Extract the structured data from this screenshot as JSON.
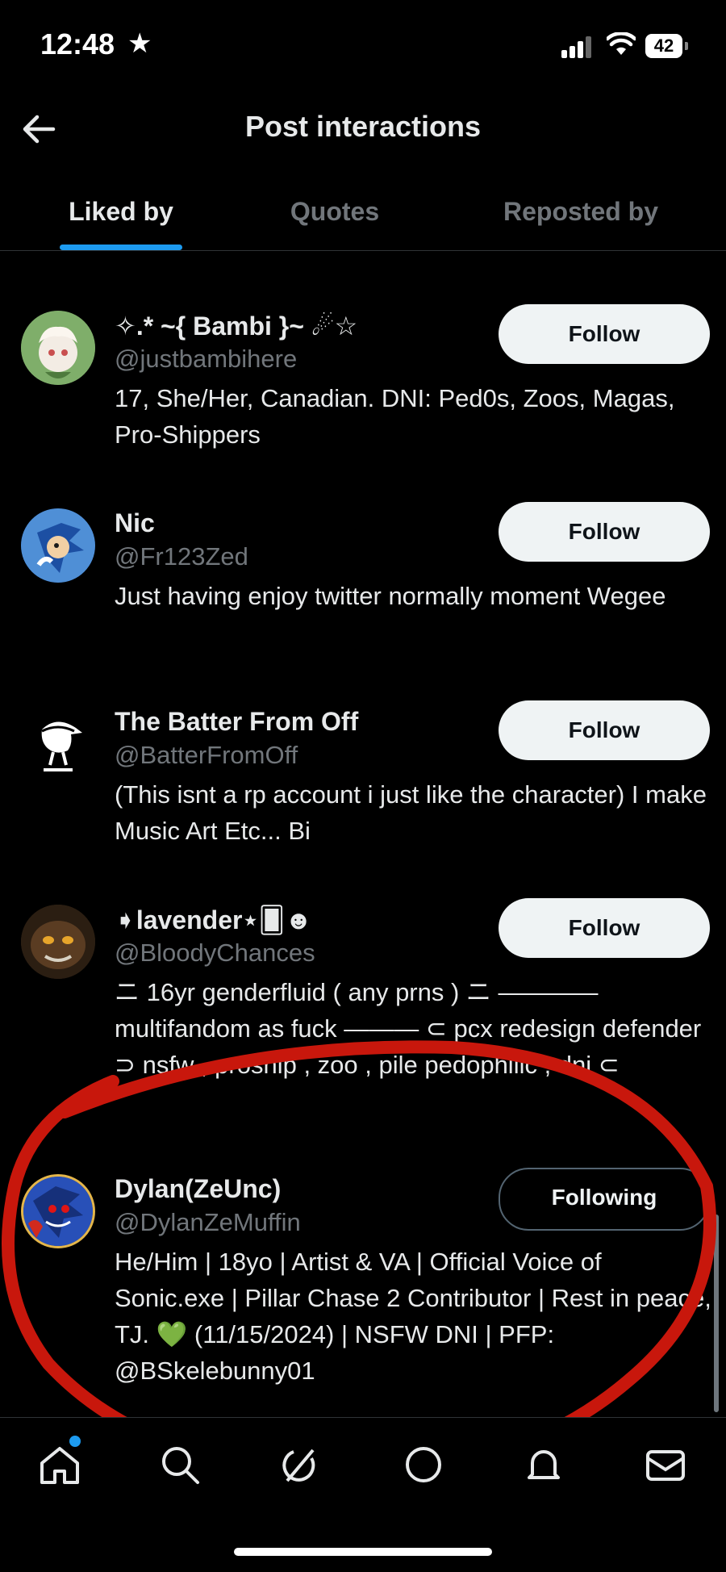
{
  "status_bar": {
    "time": "12:48",
    "battery": "42"
  },
  "header": {
    "title": "Post interactions"
  },
  "tabs": [
    {
      "label": "Liked by",
      "active": true
    },
    {
      "label": "Quotes",
      "active": false
    },
    {
      "label": "Reposted by",
      "active": false
    }
  ],
  "users": [
    {
      "name": "✧.* ~{ Bambi }~ ☄︎☆",
      "handle": "@justbambihere",
      "bio": "17, She/Her, Canadian. DNI: Ped0s, Zoos, Magas, Pro-Shippers",
      "button": "Follow",
      "avatar_color": "#7fae6a"
    },
    {
      "name": "Nic",
      "handle": "@Fr123Zed",
      "bio": "Just having enjoy twitter normally moment Wegee",
      "button": "Follow",
      "avatar_color": "#2a5fa8"
    },
    {
      "name": "The Batter From Off",
      "handle": "@BatterFromOff",
      "bio": "(This isnt a rp account i just like the character) I make Music Art Etc... Bi",
      "button": "Follow",
      "avatar_color": "#000000"
    },
    {
      "name": "➧lavender⋆🂠☻",
      "handle": "@BloodyChances",
      "bio": "ニ 16yr genderfluid ( any prns ) ニ ———— multifandom as fuck ——— ⊂ pcx redesign defender ⊃ nsfw , proship , zoo , pile pedophilic , dni ⊂",
      "button": "Follow",
      "avatar_color": "#3a2a1a"
    },
    {
      "name": "Dylan(ZeUnc)",
      "handle": "@DylanZeMuffin",
      "bio": "He/Him | 18yo | Artist & VA | Official Voice of Sonic.exe | Pillar Chase 2 Contributor | Rest in peace, TJ. 💚 (11/15/2024) | NSFW DNI | PFP: @BSkelebunny01",
      "button": "Following",
      "avatar_color": "#1f3fa0"
    }
  ],
  "nav": [
    {
      "icon": "home-icon",
      "has_notification": true
    },
    {
      "icon": "search-icon",
      "has_notification": false
    },
    {
      "icon": "grok-icon",
      "has_notification": false
    },
    {
      "icon": "communities-icon",
      "has_notification": false
    },
    {
      "icon": "bell-icon",
      "has_notification": false
    },
    {
      "icon": "mail-icon",
      "has_notification": false
    }
  ],
  "colors": {
    "background": "#000000",
    "accent": "#1d9bf0",
    "annotation": "#c8170c",
    "text_secondary": "#71767b"
  }
}
